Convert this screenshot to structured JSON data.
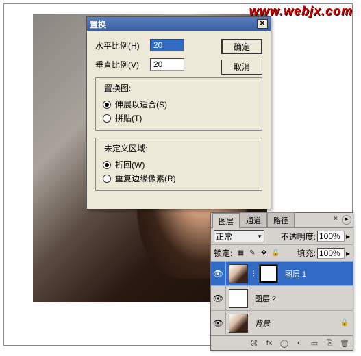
{
  "watermark": "www.webjx.com",
  "dialog": {
    "title": "置换",
    "h_label": "水平比例(H)",
    "h_value": "20",
    "v_label": "垂直比例(V)",
    "v_value": "20",
    "ok": "确定",
    "cancel": "取消",
    "displace_group": "置换图:",
    "stretch": "伸展以适合(S)",
    "tile": "拼贴(T)",
    "undef_group": "未定义区域:",
    "wrap": "折回(W)",
    "repeat": "重复边缘像素(R)"
  },
  "panel": {
    "tabs": {
      "layers": "图层",
      "channels": "通道",
      "paths": "路径"
    },
    "blend_mode": "正常",
    "opacity_label": "不透明度:",
    "opacity_value": "100%",
    "lock_label": "锁定:",
    "fill_label": "填充:",
    "fill_value": "100%",
    "layers_list": [
      {
        "name": "图层 1",
        "has_mask": true,
        "thumb": "photo",
        "active": true,
        "italic": false,
        "locked": false
      },
      {
        "name": "图层 2",
        "has_mask": false,
        "thumb": "white",
        "active": false,
        "italic": false,
        "locked": false
      },
      {
        "name": "背景",
        "has_mask": false,
        "thumb": "photo",
        "active": false,
        "italic": true,
        "locked": true
      }
    ],
    "icons": {
      "eye": "👁",
      "lock_transparent": "▦",
      "lock_brush": "✎",
      "lock_move": "✥",
      "lock_all": "🔒",
      "link": "�ん",
      "fx": "fx",
      "mask_btn": "◯",
      "adj": "◐",
      "folder": "▭",
      "new": "⎘",
      "trash": "🗑"
    }
  }
}
